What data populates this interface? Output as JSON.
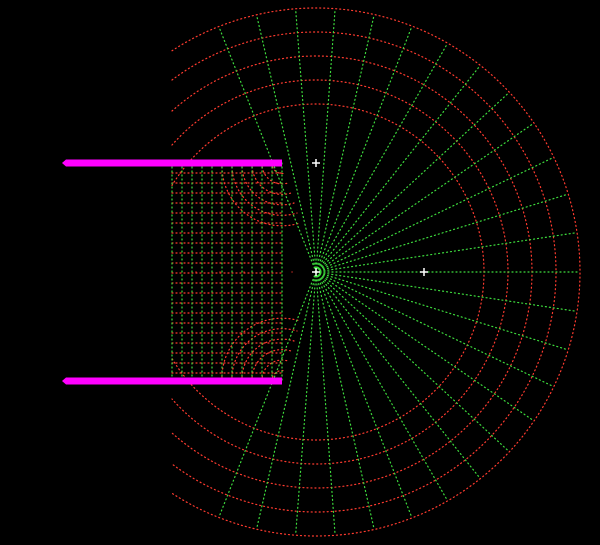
{
  "diagram": {
    "background_color": "#000000",
    "equipotential_color": "#ff3b2f",
    "field_line_color": "#3ddc3d",
    "plate_color": "#ff00ff",
    "marker_color": "#ffffff",
    "grid_style": "dotted",
    "plate_count": 2,
    "marker_count": 3,
    "marker_icon": "plus-cross-icon"
  }
}
